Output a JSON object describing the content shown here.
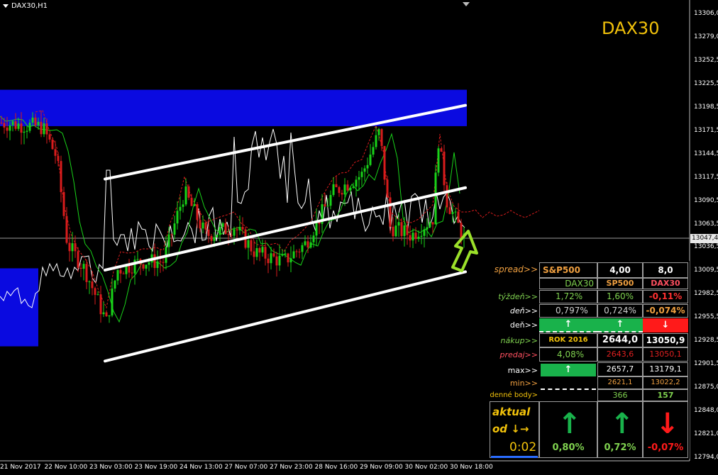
{
  "window": {
    "title": "DAX30,H1"
  },
  "brand": {
    "label": "DAX30",
    "color": "#f2c20b"
  },
  "price_axis": {
    "ticks": [
      "13306,0",
      "13279,0",
      "13252,5",
      "13225,5",
      "13198,5",
      "13171,5",
      "13144,5",
      "13117,5",
      "13090,5",
      "13063,5",
      "13036,5",
      "13009,5",
      "12982,5",
      "12955,5",
      "12928,5",
      "12901,5",
      "12875,0",
      "12848,0",
      "12821,0",
      "12794,0"
    ],
    "current": "13047,4"
  },
  "time_axis": {
    "ticks": [
      "21 Nov 2017",
      "22 Nov 10:00",
      "23 Nov 03:00",
      "23 Nov 19:00",
      "24 Nov 13:00",
      "27 Nov 07:00",
      "27 Nov 23:00",
      "28 Nov 16:00",
      "29 Nov 09:00",
      "30 Nov 02:00",
      "30 Nov 18:00"
    ]
  },
  "colors": {
    "bull": "#19d219",
    "bear": "#d81c1c",
    "zone": "#0a0ae0",
    "channel": "#ffffff",
    "table_green": "#19b24b",
    "table_red": "#ff1a1a",
    "label_green": "#7fd14f",
    "label_orange": "#f0a040",
    "label_pink": "#ff5060",
    "label_yellow": "#f2c20b"
  },
  "chart_data": {
    "type": "candlestick",
    "symbol": "DAX30",
    "timeframe": "H1",
    "ylim": [
      12790,
      13318
    ],
    "channel_lines": [
      {
        "start_time": "23 Nov 03:00",
        "start_price": 13115,
        "end_time": "30 Nov 18:00",
        "end_price": 13200
      },
      {
        "start_time": "23 Nov 03:00",
        "start_price": 13010,
        "end_time": "30 Nov 18:00",
        "end_price": 13105
      },
      {
        "start_time": "23 Nov 03:00",
        "start_price": 12905,
        "end_time": "30 Nov 18:00",
        "end_price": 13008
      }
    ],
    "zones": [
      {
        "price_from": 13176,
        "price_to": 13218
      },
      {
        "price_from": 12922,
        "price_to": 13012
      }
    ],
    "last_price": 13047.4
  },
  "panel": {
    "header": {
      "label": "spread>>",
      "col1": "S&P500",
      "col2": "4,00",
      "col3": "8,0"
    },
    "row_titles": {
      "col1": "DAX30",
      "col2": "SP500",
      "col3": "DAX30"
    },
    "tyzden": {
      "label": "týždeň>>",
      "col1": "1,72%",
      "col2": "1,60%",
      "col3": "-0,11%"
    },
    "den_pct": {
      "label": "deň>>",
      "col1": "0,797%",
      "col2": "0,724%",
      "col3": "-0,074%"
    },
    "den_dir": {
      "label": "deň>>",
      "col1": "↑",
      "col2": "↑",
      "col3": "↓"
    },
    "nakup": {
      "label": "nákup>>",
      "col1": "ROK 2016",
      "col2": "2644,0",
      "col3": "13050,9"
    },
    "predaj": {
      "label": "predaj>>",
      "col1": "4,08%",
      "col2": "2643,6",
      "col3": "13050,1"
    },
    "max": {
      "label": "max>>",
      "col1": "↑",
      "col2": "2657,7",
      "col3": "13179,1"
    },
    "min": {
      "label": "min>>",
      "col2": "2621,1",
      "col3": "13022,2"
    },
    "denne_body": {
      "label": "denné body>",
      "col2": "366",
      "col3": "157"
    },
    "aktual": {
      "line1": "aktual",
      "line2": "od ↓→",
      "timer": "0:02"
    },
    "big_arrows": {
      "col1": "↑",
      "col2": "↑",
      "col3": "↓"
    },
    "totals": {
      "col1": "0,80%",
      "col2": "0,72%",
      "col3": "-0,07%"
    }
  }
}
